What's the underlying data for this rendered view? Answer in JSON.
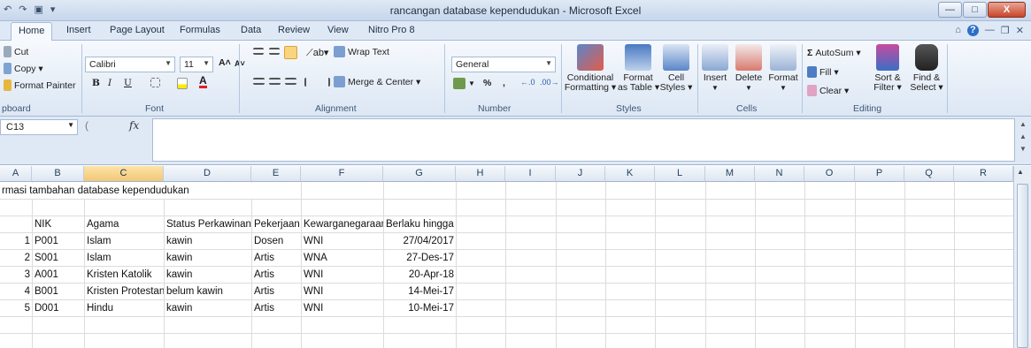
{
  "window": {
    "title": "rancangan database  kependudukan  -  Microsoft Excel",
    "qat": [
      "↶",
      "↷",
      "▣",
      "▾"
    ],
    "controls": [
      "—",
      "□",
      "X"
    ]
  },
  "ribbon_tabs": [
    "Home",
    "Insert",
    "Page Layout",
    "Formulas",
    "Data",
    "Review",
    "View",
    "Nitro Pro 8"
  ],
  "ribbon_right": [
    "⌂",
    "?",
    "—",
    "❐",
    "✕"
  ],
  "clipboard": {
    "cut": "Cut",
    "copy": "Copy ▾",
    "painter": "Format Painter",
    "label": "pboard"
  },
  "font": {
    "name": "Calibri",
    "size": "11",
    "grow": "A˄",
    "shrink": "A˅",
    "bold": "B",
    "italic": "I",
    "underline": "U",
    "label": "Font"
  },
  "alignment": {
    "wrap": "Wrap Text",
    "merge": "Merge & Center ▾",
    "label": "Alignment"
  },
  "number": {
    "format": "General",
    "pct": "%",
    "comma": ",",
    "label": "Number"
  },
  "styles": {
    "conditional": "Conditional\nFormatting ▾",
    "format_table": "Format\nas Table ▾",
    "cell_styles": "Cell\nStyles ▾",
    "label": "Styles"
  },
  "cells": {
    "insert": "Insert",
    "delete": "Delete",
    "format": "Format",
    "label": "Cells"
  },
  "editing": {
    "autosum": "AutoSum ▾",
    "fill": "Fill ▾",
    "clear": "Clear ▾",
    "sort": "Sort &\nFilter ▾",
    "find": "Find &\nSelect ▾",
    "label": "Editing"
  },
  "formula_bar": {
    "name_box": "C13",
    "fx": "fx"
  },
  "columns": [
    "A",
    "B",
    "C",
    "D",
    "E",
    "F",
    "G",
    "H",
    "I",
    "J",
    "K",
    "L",
    "M",
    "N",
    "O",
    "P",
    "Q",
    "R"
  ],
  "sheet": {
    "title_text": "rmasi tambahan database kependudukan",
    "headers": [
      "NIK",
      "Agama",
      "Status Perkawinan",
      "Pekerjaan",
      "Kewarganegaraan",
      "Berlaku hingga"
    ],
    "rows": [
      [
        "1",
        "P001",
        "Islam",
        "kawin",
        "Dosen",
        "WNI",
        "27/04/2017"
      ],
      [
        "2",
        "S001",
        "Islam",
        "kawin",
        "Artis",
        "WNA",
        "27-Des-17"
      ],
      [
        "3",
        "A001",
        "Kristen Katolik",
        "kawin",
        "Artis",
        "WNI",
        "20-Apr-18"
      ],
      [
        "4",
        "B001",
        "Kristen Protestan",
        "belum kawin",
        "Artis",
        "WNI",
        "14-Mei-17"
      ],
      [
        "5",
        "D001",
        "Hindu",
        "kawin",
        "Artis",
        "WNI",
        "10-Mei-17"
      ]
    ]
  }
}
